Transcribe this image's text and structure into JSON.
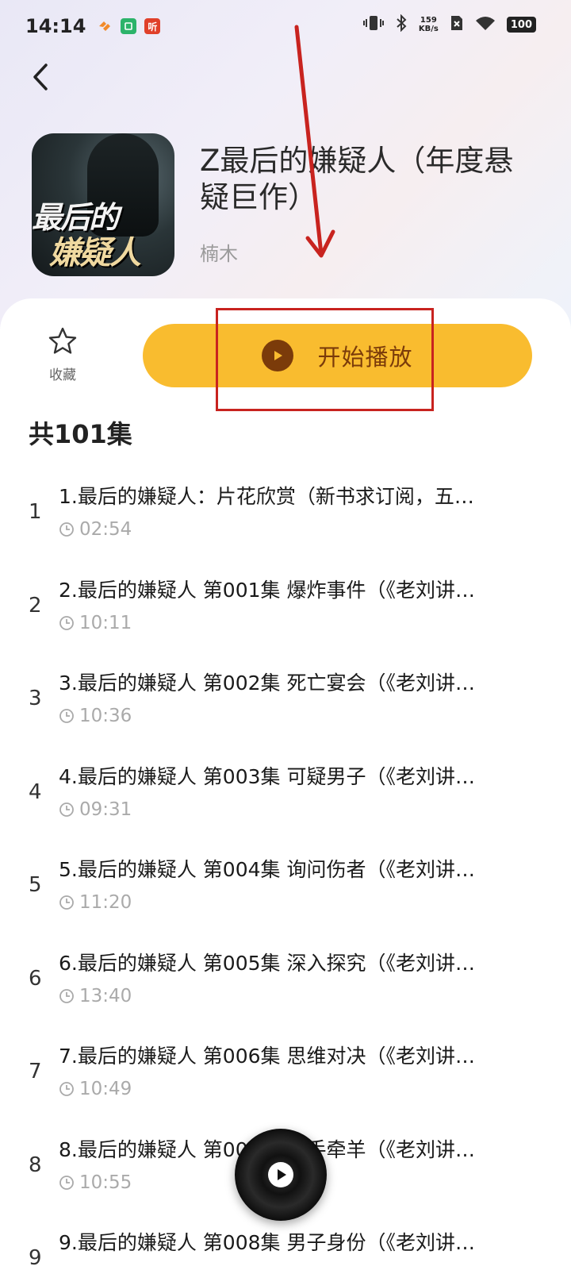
{
  "status_bar": {
    "time": "14:14",
    "speed_value": "159",
    "speed_unit": "KB/s",
    "battery": "100",
    "app_icon_3_label": "听"
  },
  "book": {
    "title": "Z最后的嫌疑人（年度悬疑巨作）",
    "author": "楠木",
    "cover_text_line1": "最后的",
    "cover_text_line2": "嫌疑人"
  },
  "actions": {
    "favorite_label": "收藏",
    "play_label": "开始播放"
  },
  "episodes_header": "共101集",
  "episodes": [
    {
      "num": "1",
      "title": "1.最后的嫌疑人：片花欣赏（新书求订阅，五…",
      "duration": "02:54"
    },
    {
      "num": "2",
      "title": "2.最后的嫌疑人 第001集 爆炸事件（《老刘讲…",
      "duration": "10:11"
    },
    {
      "num": "3",
      "title": "3.最后的嫌疑人 第002集 死亡宴会（《老刘讲…",
      "duration": "10:36"
    },
    {
      "num": "4",
      "title": "4.最后的嫌疑人 第003集 可疑男子（《老刘讲…",
      "duration": "09:31"
    },
    {
      "num": "5",
      "title": "5.最后的嫌疑人 第004集 询问伤者（《老刘讲…",
      "duration": "11:20"
    },
    {
      "num": "6",
      "title": "6.最后的嫌疑人 第005集 深入探究（《老刘讲…",
      "duration": "13:40"
    },
    {
      "num": "7",
      "title": "7.最后的嫌疑人 第006集 思维对决（《老刘讲…",
      "duration": "10:49"
    },
    {
      "num": "8",
      "title": "8.最后的嫌疑人 第007集 顺手牵羊（《老刘讲…",
      "duration": "10:55"
    },
    {
      "num": "9",
      "title": "9.最后的嫌疑人 第008集 男子身份（《老刘讲…",
      "duration": ""
    }
  ],
  "colors": {
    "accent": "#f9bc2f",
    "accent_text": "#7b3b0a",
    "annotation": "#c8231f"
  }
}
